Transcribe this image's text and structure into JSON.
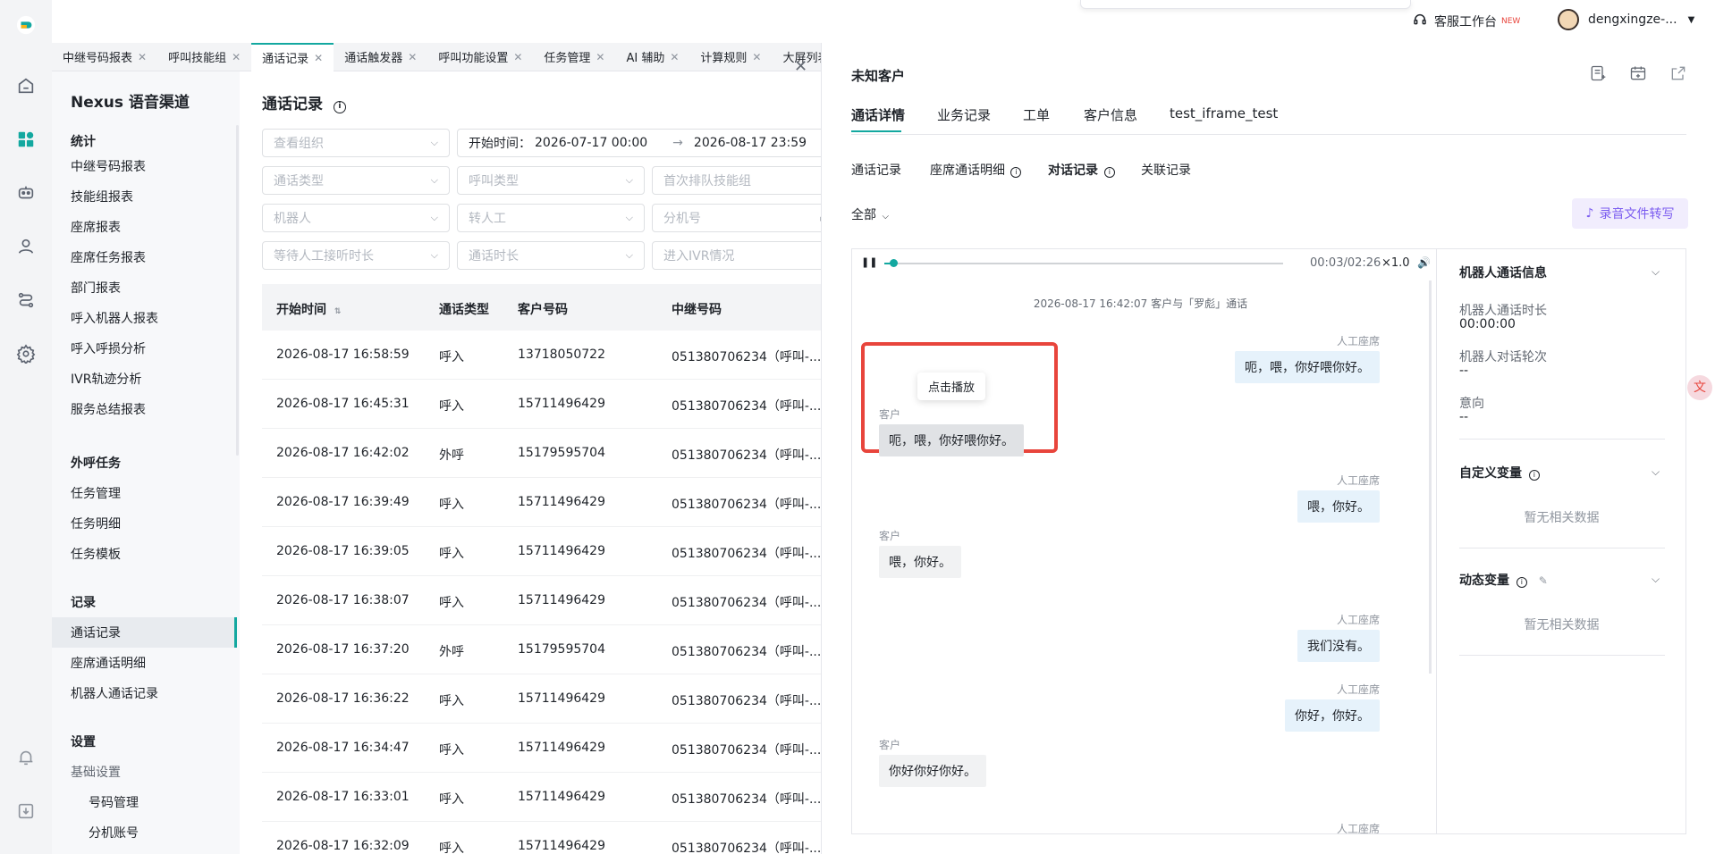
{
  "rail": {
    "icons": [
      "logo-icon",
      "home-icon",
      "dashboard-icon",
      "robot-icon",
      "agent-icon",
      "route-icon",
      "settings-icon",
      "bell-icon",
      "download-icon"
    ]
  },
  "header": {
    "workbench_label": "客服工作台",
    "workbench_badge": "NEW",
    "user_name": "dengxingze-..."
  },
  "tabs": [
    {
      "label": "中继号码报表"
    },
    {
      "label": "呼叫技能组"
    },
    {
      "label": "通话记录"
    },
    {
      "label": "通话触发器"
    },
    {
      "label": "呼叫功能设置"
    },
    {
      "label": "任务管理"
    },
    {
      "label": "AI 辅助"
    },
    {
      "label": "计算规则"
    },
    {
      "label": "大屏列表"
    }
  ],
  "nav": {
    "app_title": "Nexus 语音渠道",
    "sec_stats": "统计",
    "stats_items": [
      "中继号码报表",
      "技能组报表",
      "座席报表",
      "座席任务报表",
      "部门报表",
      "呼入机器人报表",
      "呼入呼损分析",
      "IVR轨迹分析",
      "服务总结报表"
    ],
    "sec_outbound": "外呼任务",
    "outbound_items": [
      "任务管理",
      "任务明细",
      "任务模板"
    ],
    "sec_records": "记录",
    "records_items": [
      "通话记录",
      "座席通话明细",
      "机器人通话记录"
    ],
    "sec_settings": "设置",
    "settings_group": "基础设置",
    "settings_items": [
      "号码管理",
      "分机账号"
    ]
  },
  "main": {
    "title": "通话记录",
    "filters": {
      "org": "查看组织",
      "start_label": "开始时间：",
      "start_from": "2026-07-17 00:00",
      "start_to": "2026-08-17 23:59",
      "call_type": "通话类型",
      "call_kind": "呼叫类型",
      "first_queue": "首次排队技能组",
      "robot": "机器人",
      "transfer": "转人工",
      "extension": "分机号",
      "wait_time": "等待人工接听时长",
      "duration": "通话时长",
      "ivr": "进入IVR情况"
    },
    "columns": [
      "开始时间",
      "通话类型",
      "客户号码",
      "中继号码"
    ],
    "rows": [
      [
        "2026-08-17 16:58:59",
        "呼入",
        "13718050722",
        "051380706234（呼叫-..."
      ],
      [
        "2026-08-17 16:45:31",
        "呼入",
        "15711496429",
        "051380706234（呼叫-..."
      ],
      [
        "2026-08-17 16:42:02",
        "外呼",
        "15179595704",
        "051380706234（呼叫-..."
      ],
      [
        "2026-08-17 16:39:49",
        "呼入",
        "15711496429",
        "051380706234（呼叫-..."
      ],
      [
        "2026-08-17 16:39:05",
        "呼入",
        "15711496429",
        "051380706234（呼叫-..."
      ],
      [
        "2026-08-17 16:38:07",
        "呼入",
        "15711496429",
        "051380706234（呼叫-..."
      ],
      [
        "2026-08-17 16:37:20",
        "外呼",
        "15179595704",
        "051380706234（呼叫-..."
      ],
      [
        "2026-08-17 16:36:22",
        "呼入",
        "15711496429",
        "051380706234（呼叫-..."
      ],
      [
        "2026-08-17 16:34:47",
        "呼入",
        "15711496429",
        "051380706234（呼叫-..."
      ],
      [
        "2026-08-17 16:33:01",
        "呼入",
        "15711496429",
        "051380706234（呼叫-..."
      ],
      [
        "2026-08-17 16:32:09",
        "呼入",
        "15711496429",
        "051380706234（呼叫-..."
      ]
    ]
  },
  "drawer": {
    "title": "未知客户",
    "tabs": [
      "通话详情",
      "业务记录",
      "工单",
      "客户信息",
      "test_iframe_test"
    ],
    "sub_tabs": [
      "通话记录",
      "座席通话明细",
      "对话记录",
      "关联记录"
    ],
    "filter_all": "全部",
    "transcribe_button": "录音文件转写",
    "player": {
      "time": "00:03/02:26",
      "speed": "×1.0",
      "progress_fraction": 0.023
    },
    "chat_header": "2026-08-17 16:42:07 客户与「罗彪」通话",
    "tooltip": "点击播放",
    "messages": [
      {
        "speaker": "人工座席",
        "text": "呃，喂，你好喂你好。",
        "side": "right"
      },
      {
        "speaker": "客户",
        "text": "呃，喂，你好喂你好。",
        "side": "left"
      },
      {
        "speaker": "人工座席",
        "text": "喂，你好。",
        "side": "right"
      },
      {
        "speaker": "客户",
        "text": "喂，你好。",
        "side": "left"
      },
      {
        "speaker": "人工座席",
        "text": "我们没有。",
        "side": "right"
      },
      {
        "speaker": "人工座席",
        "text": "你好，你好。",
        "side": "right"
      },
      {
        "speaker": "客户",
        "text": "你好你好你好。",
        "side": "left"
      },
      {
        "speaker": "人工座席",
        "text": "",
        "side": "right"
      }
    ],
    "side": {
      "robot_section": "机器人通话信息",
      "robot_duration_label": "机器人通话时长",
      "robot_duration_value": "00:00:00",
      "robot_turns_label": "机器人对话轮次",
      "robot_turns_value": "--",
      "intent_label": "意向",
      "intent_value": "--",
      "custom_section": "自定义变量",
      "custom_empty": "暂无相关数据",
      "dynamic_section": "动态变量",
      "dynamic_empty": "暂无相关数据"
    }
  },
  "colors": {
    "accent": "#13a8a0",
    "highlight": "#e8453c",
    "purple": "#7b5cf0"
  }
}
